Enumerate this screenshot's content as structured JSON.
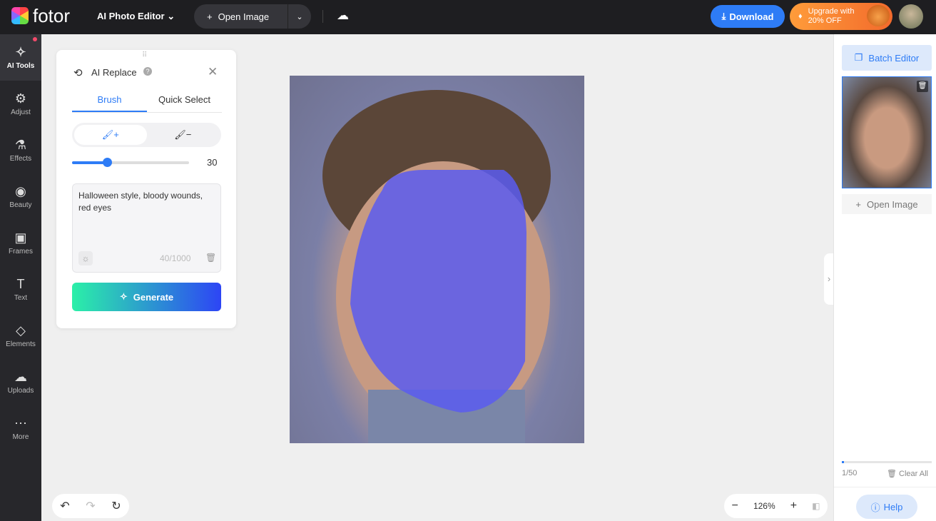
{
  "header": {
    "brand": "fotor",
    "editor_menu": "AI Photo Editor",
    "open_image": "Open Image",
    "download": "Download",
    "upgrade_line1": "Upgrade with",
    "upgrade_line2": "20% OFF"
  },
  "sidebar": {
    "items": [
      {
        "label": "AI Tools",
        "icon": "✧"
      },
      {
        "label": "Adjust",
        "icon": "⚙"
      },
      {
        "label": "Effects",
        "icon": "⚗"
      },
      {
        "label": "Beauty",
        "icon": "◉"
      },
      {
        "label": "Frames",
        "icon": "▣"
      },
      {
        "label": "Text",
        "icon": "T"
      },
      {
        "label": "Elements",
        "icon": "◇"
      },
      {
        "label": "Uploads",
        "icon": "☁"
      },
      {
        "label": "More",
        "icon": "⋯"
      }
    ]
  },
  "panel": {
    "title": "AI Replace",
    "tabs": [
      "Brush",
      "Quick Select"
    ],
    "brush_size": "30",
    "brush_fraction": 0.3,
    "prompt": "Halloween style, bloody wounds, red eyes",
    "char_count": "40/1000",
    "generate": "Generate"
  },
  "right": {
    "batch_editor": "Batch Editor",
    "open_image": "Open Image",
    "count": "1/50",
    "clear_all": "Clear All",
    "help": "Help"
  },
  "zoom": {
    "level": "126%"
  },
  "colors": {
    "accent": "#2e7cf6",
    "mask": "#5a5cf0"
  }
}
